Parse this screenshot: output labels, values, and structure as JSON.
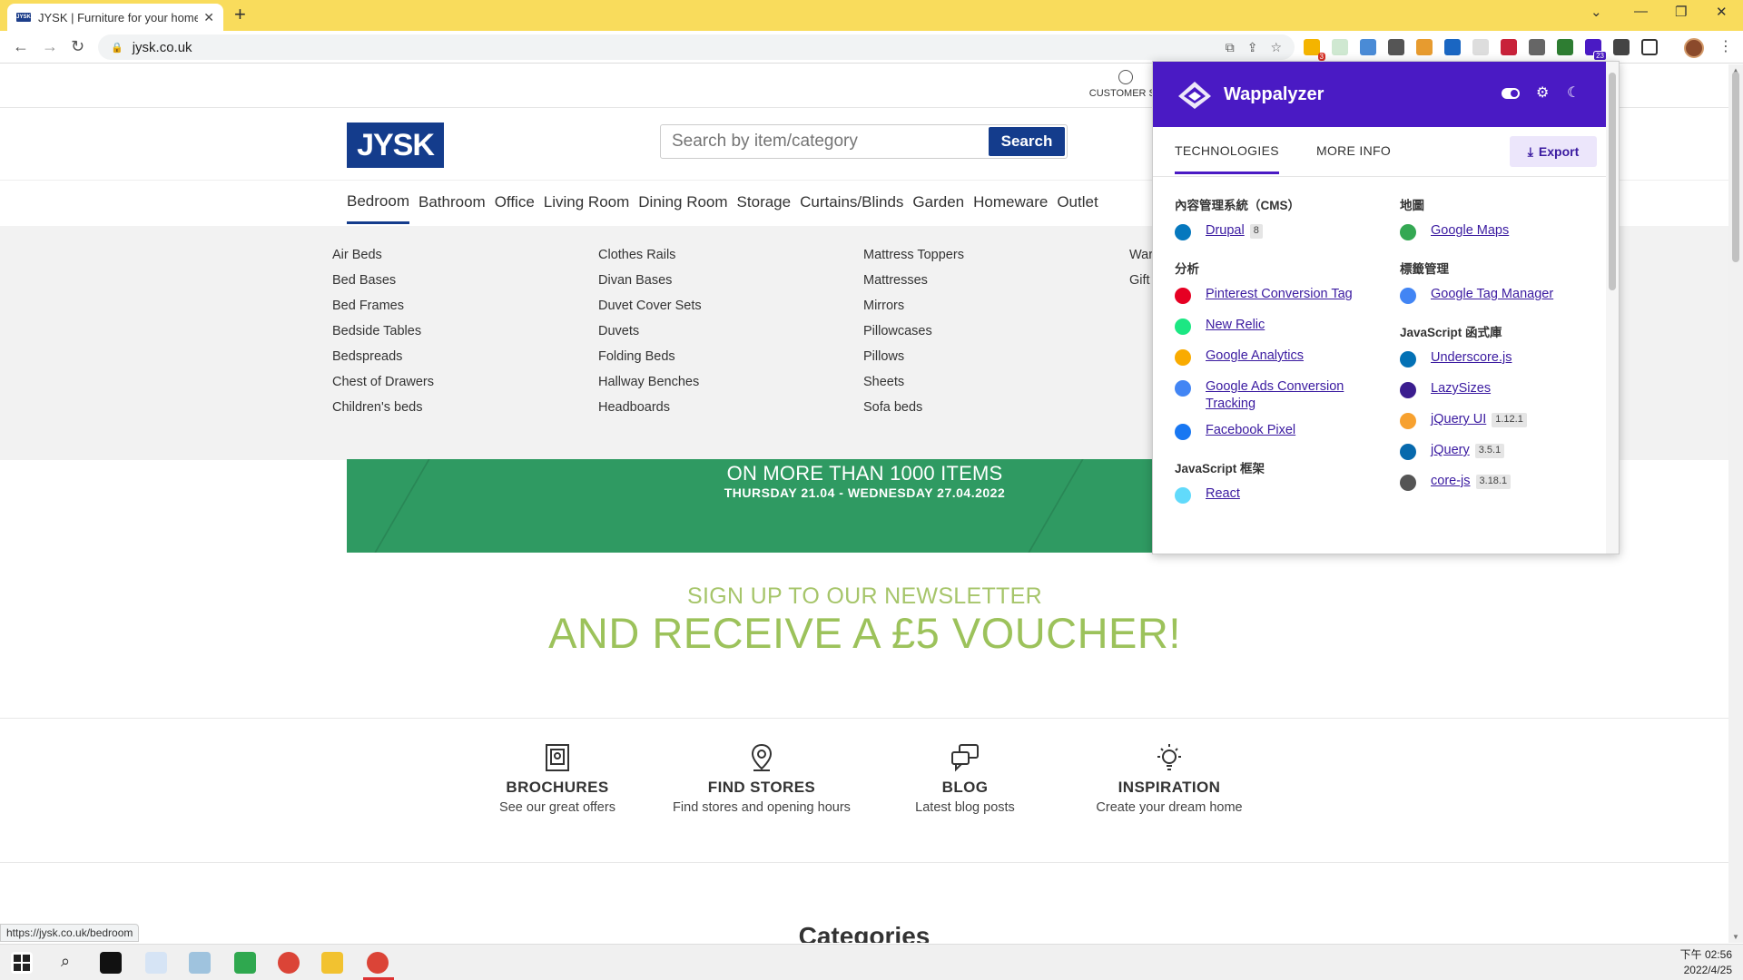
{
  "browser": {
    "tab_title": "JYSK | Furniture for your home",
    "url": "jysk.co.uk",
    "status_url": "https://jysk.co.uk/bedroom",
    "ext_badge_1": "3",
    "ext_badge_2": "23"
  },
  "site": {
    "logo_text": "JYSK",
    "customer_service_label": "CUSTOMER SE",
    "search_placeholder": "Search by item/category",
    "search_button": "Search",
    "nav": [
      "Bedroom",
      "Bathroom",
      "Office",
      "Living Room",
      "Dining Room",
      "Storage",
      "Curtains/Blinds",
      "Garden",
      "Homeware",
      "Outlet"
    ],
    "nav_active": "Bedroom",
    "megamenu": {
      "col1": [
        "Air Beds",
        "Bed Bases",
        "Bed Frames",
        "Bedside Tables",
        "Bedspreads",
        "Chest of Drawers",
        "Children's beds"
      ],
      "col2": [
        "Clothes Rails",
        "Divan Bases",
        "Duvet Cover Sets",
        "Duvets",
        "Folding Beds",
        "Hallway Benches",
        "Headboards"
      ],
      "col3": [
        "Mattress Toppers",
        "Mattresses",
        "Mirrors",
        "Pillowcases",
        "Pillows",
        "Sheets",
        "Sofa beds"
      ],
      "col4": [
        "War",
        "Gift"
      ]
    },
    "promo": {
      "line1": "ON MORE THAN 1000 ITEMS",
      "line2": "THURSDAY 21.04 - WEDNESDAY 27.04.2022"
    },
    "newsletter": {
      "line1": "SIGN UP TO OUR NEWSLETTER",
      "line2": "AND RECEIVE A £5 VOUCHER!"
    },
    "features": [
      {
        "title": "BROCHURES",
        "subtitle": "See our great offers",
        "icon": "brochure-icon"
      },
      {
        "title": "FIND STORES",
        "subtitle": "Find stores and opening hours",
        "icon": "location-pin-icon"
      },
      {
        "title": "BLOG",
        "subtitle": "Latest blog posts",
        "icon": "chat-bubbles-icon"
      },
      {
        "title": "INSPIRATION",
        "subtitle": "Create your dream home",
        "icon": "lightbulb-icon"
      }
    ],
    "categories_heading": "Categories"
  },
  "wappalyzer": {
    "title": "Wappalyzer",
    "tab_technologies": "TECHNOLOGIES",
    "tab_more_info": "MORE INFO",
    "export_label": "Export",
    "left": [
      {
        "category": "內容管理系統（CMS）",
        "items": [
          {
            "name": "Drupal",
            "version": "8",
            "icon": "drupal-icon",
            "color": "#0678be"
          }
        ]
      },
      {
        "category": "分析",
        "items": [
          {
            "name": "Pinterest Conversion Tag",
            "version": "",
            "icon": "pinterest-icon",
            "color": "#e60023"
          },
          {
            "name": "New Relic",
            "version": "",
            "icon": "new-relic-icon",
            "color": "#1ce783"
          },
          {
            "name": "Google Analytics",
            "version": "",
            "icon": "google-analytics-icon",
            "color": "#f9ab00"
          },
          {
            "name": "Google Ads Conversion Tracking",
            "version": "",
            "icon": "google-icon",
            "color": "#4285f4"
          },
          {
            "name": "Facebook Pixel",
            "version": "",
            "icon": "facebook-icon",
            "color": "#1877f2"
          }
        ]
      },
      {
        "category": "JavaScript 框架",
        "items": [
          {
            "name": "React",
            "version": "",
            "icon": "react-icon",
            "color": "#61dafb"
          }
        ]
      }
    ],
    "right": [
      {
        "category": "地圖",
        "items": [
          {
            "name": "Google Maps",
            "version": "",
            "icon": "google-maps-icon",
            "color": "#34a853"
          }
        ]
      },
      {
        "category": "標籤管理",
        "items": [
          {
            "name": "Google Tag Manager",
            "version": "",
            "icon": "google-tag-manager-icon",
            "color": "#4285f4"
          }
        ]
      },
      {
        "category": "JavaScript 函式庫",
        "items": [
          {
            "name": "Underscore.js",
            "version": "",
            "icon": "underscore-icon",
            "color": "#0371b5"
          },
          {
            "name": "LazySizes",
            "version": "",
            "icon": "lazysizes-icon",
            "color": "#3b1d8f"
          },
          {
            "name": "jQuery UI",
            "version": "1.12.1",
            "icon": "jquery-ui-icon",
            "color": "#f7a12f"
          },
          {
            "name": "jQuery",
            "version": "3.5.1",
            "icon": "jquery-icon",
            "color": "#0769ad"
          },
          {
            "name": "core-js",
            "version": "3.18.1",
            "icon": "core-js-icon",
            "color": "#555555"
          }
        ]
      }
    ]
  },
  "taskbar": {
    "time": "下午 02:56",
    "date": "2022/4/25"
  }
}
